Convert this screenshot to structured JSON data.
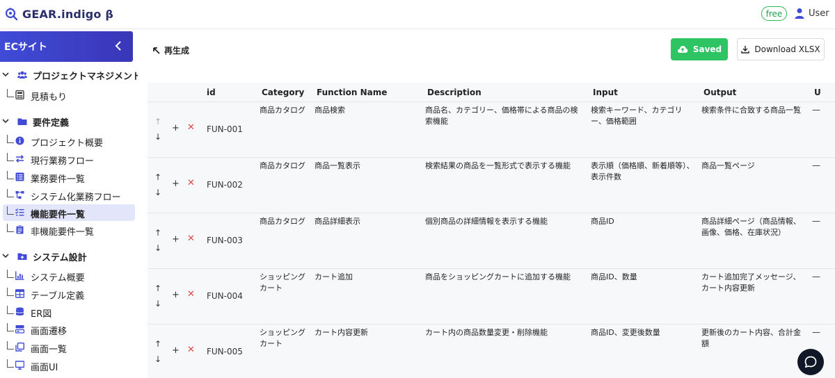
{
  "app": {
    "logo_text": "GEAR.indigo β"
  },
  "header": {
    "plan_badge": "free",
    "user_label": "User"
  },
  "sidebar": {
    "project_name": "ECサイト",
    "sections": [
      {
        "label": "プロジェクトマネジメント",
        "icon": "users-icon",
        "items": [
          {
            "label": "見積もり",
            "icon": "calculator-icon"
          }
        ]
      },
      {
        "label": "要件定義",
        "icon": "folder-icon",
        "items": [
          {
            "label": "プロジェクト概要",
            "icon": "info-icon"
          },
          {
            "label": "現行業務フロー",
            "icon": "swap-icon"
          },
          {
            "label": "業務要件一覧",
            "icon": "list-icon"
          },
          {
            "label": "システム化業務フロー",
            "icon": "flow-icon"
          },
          {
            "label": "機能要件一覧",
            "icon": "checklist-icon",
            "active": true
          },
          {
            "label": "非機能要件一覧",
            "icon": "clipboard-icon"
          }
        ]
      },
      {
        "label": "システム設計",
        "icon": "folder-plus-icon",
        "items": [
          {
            "label": "システム概要",
            "icon": "chart-icon"
          },
          {
            "label": "テーブル定義",
            "icon": "table-icon"
          },
          {
            "label": "ER図",
            "icon": "database-icon"
          },
          {
            "label": "画面遷移",
            "icon": "transition-icon"
          },
          {
            "label": "画面一覧",
            "icon": "copy-icon"
          },
          {
            "label": "画面UI",
            "icon": "monitor-icon"
          }
        ]
      }
    ]
  },
  "toolbar": {
    "regenerate_label": "再生成",
    "saved_label": "Saved",
    "download_label": "Download XLSX"
  },
  "table": {
    "columns": [
      "id",
      "Category",
      "Function Name",
      "Description",
      "Input",
      "Output",
      "U"
    ],
    "rows": [
      {
        "id": "FUN-001",
        "category": "商品カタログ",
        "name": "商品検索",
        "description": "商品名、カテゴリー、価格帯による商品の検索機能",
        "input": "検索キーワード、カテゴリー、価格範囲",
        "output": "検索条件に合致する商品一覧",
        "extra": "—"
      },
      {
        "id": "FUN-002",
        "category": "商品カタログ",
        "name": "商品一覧表示",
        "description": "検索結果の商品を一覧形式で表示する機能",
        "input": "表示順（価格順、新着順等）、表示件数",
        "output": "商品一覧ページ",
        "extra": "—"
      },
      {
        "id": "FUN-003",
        "category": "商品カタログ",
        "name": "商品詳細表示",
        "description": "個別商品の詳細情報を表示する機能",
        "input": "商品ID",
        "output": "商品詳細ページ（商品情報、画像、価格、在庫状況）",
        "extra": "—"
      },
      {
        "id": "FUN-004",
        "category": "ショッピングカート",
        "name": "カート追加",
        "description": "商品をショッピングカートに追加する機能",
        "input": "商品ID、数量",
        "output": "カート追加完了メッセージ、カート内容更新",
        "extra": "—"
      },
      {
        "id": "FUN-005",
        "category": "ショッピングカート",
        "name": "カート内容更新",
        "description": "カート内の商品数量変更・削除機能",
        "input": "商品ID、変更後数量",
        "output": "更新後のカート内容、合計金額",
        "extra": "—"
      }
    ]
  },
  "colors": {
    "brand": "#3f4bd6",
    "saved_green": "#2ec463",
    "delete_red": "#e04848",
    "active_nav": "#e3e6fb"
  }
}
